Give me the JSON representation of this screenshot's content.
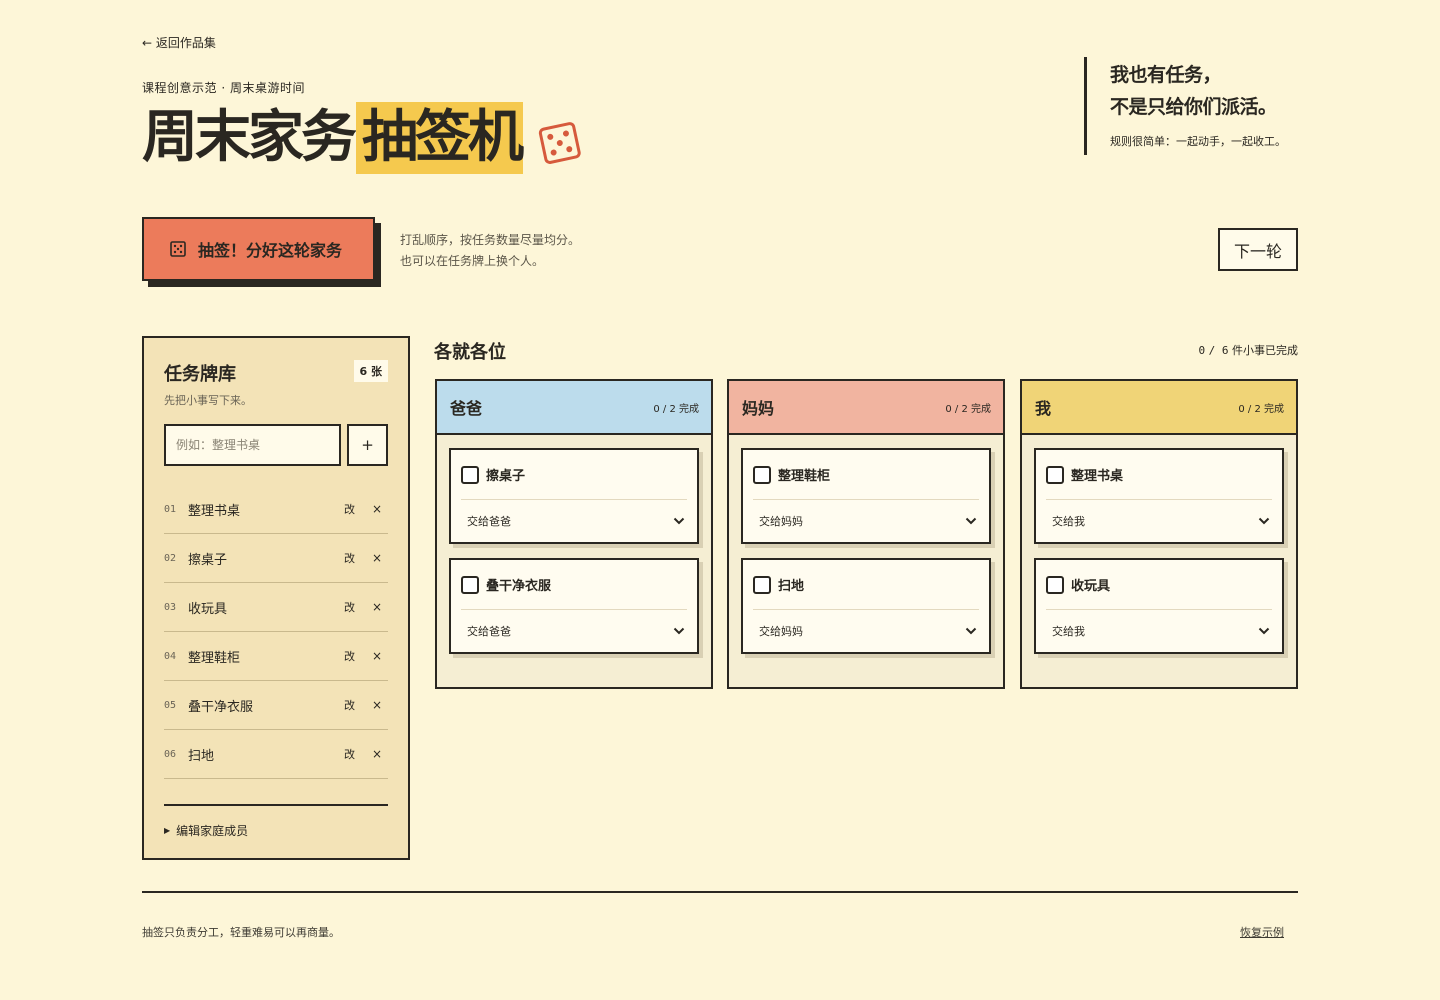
{
  "header": {
    "back_link": "← 返回作品集",
    "eyebrow": "课程创意示范 · 周末桌游时间",
    "title_plain": "周末家务",
    "title_highlight": "抽签机",
    "quote_line1": "我也有任务，",
    "quote_line2": "不是只给你们派活。",
    "quote_sub": "规则很简单：一起动手，一起收工。"
  },
  "actions": {
    "draw_label": "抽签！分好这轮家务",
    "hint_line1": "打乱顺序，按任务数量尽量均分。",
    "hint_line2": "也可以在任务牌上换个人。",
    "next_label": "下一轮"
  },
  "library": {
    "title": "任务牌库",
    "count": "6 张",
    "desc": "先把小事写下来。",
    "input_placeholder": "例如：整理书桌",
    "add_label": "+",
    "edit_label": "改",
    "delete_label": "×",
    "items": [
      {
        "no": "01",
        "name": "整理书桌"
      },
      {
        "no": "02",
        "name": "擦桌子"
      },
      {
        "no": "03",
        "name": "收玩具"
      },
      {
        "no": "04",
        "name": "整理鞋柜"
      },
      {
        "no": "05",
        "name": "叠干净衣服"
      },
      {
        "no": "06",
        "name": "扫地"
      }
    ],
    "family_toggle": "编辑家庭成员"
  },
  "board": {
    "title": "各就各位",
    "progress_done": "0",
    "progress_total": "6",
    "progress_label": "件小事已完成",
    "columns": [
      {
        "name": "爸爸",
        "count": "0 / 2 完成",
        "color": "#bcdcec",
        "cards": [
          {
            "task": "擦桌子",
            "assignee": "交给爸爸"
          },
          {
            "task": "叠干净衣服",
            "assignee": "交给爸爸"
          }
        ]
      },
      {
        "name": "妈妈",
        "count": "0 / 2 完成",
        "color": "#f1b4a0",
        "cards": [
          {
            "task": "整理鞋柜",
            "assignee": "交给妈妈"
          },
          {
            "task": "扫地",
            "assignee": "交给妈妈"
          }
        ]
      },
      {
        "name": "我",
        "count": "0 / 2 完成",
        "color": "#f0d477",
        "cards": [
          {
            "task": "整理书桌",
            "assignee": "交给我"
          },
          {
            "task": "收玩具",
            "assignee": "交给我"
          }
        ]
      }
    ]
  },
  "footer": {
    "note": "抽签只负责分工，轻重难易可以再商量。",
    "restore": "恢复示例"
  },
  "colors": {
    "background": "#fdf6d8",
    "accent_red": "#ec7b5b",
    "highlight_yellow": "#f5c94e",
    "ink": "#2a2721"
  }
}
